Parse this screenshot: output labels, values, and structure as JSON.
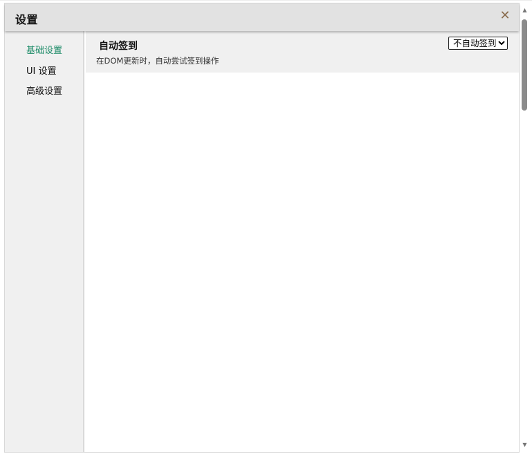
{
  "dialog": {
    "title": "设置",
    "close_glyph": "✕",
    "close_icon": "close-icon"
  },
  "sidebar": {
    "items": [
      {
        "label": "基础设置",
        "active": true
      },
      {
        "label": "UI 设置",
        "active": false
      },
      {
        "label": "高级设置",
        "active": false
      }
    ]
  },
  "settings": [
    {
      "title": "自动签到",
      "description": "在DOM更新时，自动尝试签到操作",
      "selected": "不自动签到"
    }
  ],
  "scrollbar": {
    "up_icon": "chevron-up-icon",
    "down_icon": "chevron-down-icon"
  },
  "colors": {
    "accent": "#1a8a66",
    "header_bg": "#e2e2e2",
    "sidebar_bg": "#f0f0f0",
    "close": "#8a6d4f"
  }
}
